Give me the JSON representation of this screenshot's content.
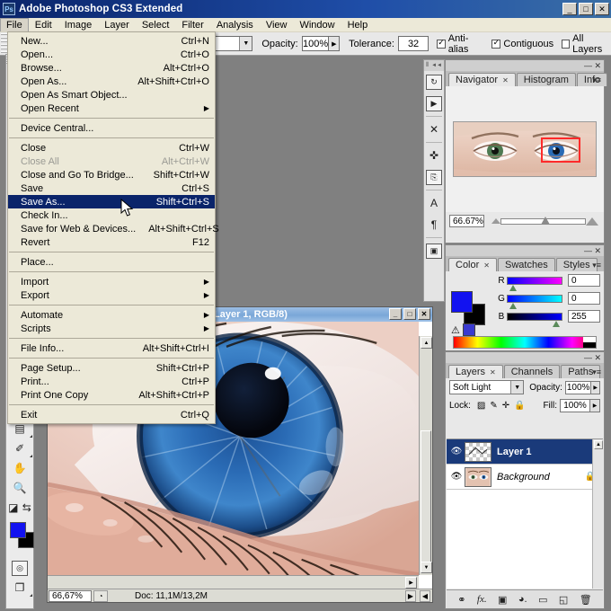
{
  "window": {
    "title": "Adobe Photoshop CS3 Extended",
    "logo": "ps-logo",
    "minimize": "_",
    "maximize": "□",
    "close": "✕"
  },
  "menubar": {
    "items": [
      {
        "label": "File"
      },
      {
        "label": "Edit"
      },
      {
        "label": "Image"
      },
      {
        "label": "Layer"
      },
      {
        "label": "Select"
      },
      {
        "label": "Filter"
      },
      {
        "label": "Analysis"
      },
      {
        "label": "View"
      },
      {
        "label": "Window"
      },
      {
        "label": "Help"
      }
    ]
  },
  "file_menu": {
    "items": [
      {
        "label": "New...",
        "accel": "Ctrl+N",
        "type": "item"
      },
      {
        "label": "Open...",
        "accel": "Ctrl+O",
        "type": "item"
      },
      {
        "label": "Browse...",
        "accel": "Alt+Ctrl+O",
        "type": "item"
      },
      {
        "label": "Open As...",
        "accel": "Alt+Shift+Ctrl+O",
        "type": "item"
      },
      {
        "label": "Open As Smart Object...",
        "accel": "",
        "type": "item"
      },
      {
        "label": "Open Recent",
        "accel": "",
        "type": "submenu"
      },
      {
        "type": "separator"
      },
      {
        "label": "Device Central...",
        "accel": "",
        "type": "item"
      },
      {
        "type": "separator"
      },
      {
        "label": "Close",
        "accel": "Ctrl+W",
        "type": "item"
      },
      {
        "label": "Close All",
        "accel": "Alt+Ctrl+W",
        "type": "disabled"
      },
      {
        "label": "Close and Go To Bridge...",
        "accel": "Shift+Ctrl+W",
        "type": "item"
      },
      {
        "label": "Save",
        "accel": "Ctrl+S",
        "type": "item"
      },
      {
        "label": "Save As...",
        "accel": "Shift+Ctrl+S",
        "type": "selected"
      },
      {
        "label": "Check In...",
        "accel": "",
        "type": "item"
      },
      {
        "label": "Save for Web & Devices...",
        "accel": "Alt+Shift+Ctrl+S",
        "type": "item"
      },
      {
        "label": "Revert",
        "accel": "F12",
        "type": "item"
      },
      {
        "type": "separator"
      },
      {
        "label": "Place...",
        "accel": "",
        "type": "item"
      },
      {
        "type": "separator"
      },
      {
        "label": "Import",
        "accel": "",
        "type": "submenu"
      },
      {
        "label": "Export",
        "accel": "",
        "type": "submenu"
      },
      {
        "type": "separator"
      },
      {
        "label": "Automate",
        "accel": "",
        "type": "submenu"
      },
      {
        "label": "Scripts",
        "accel": "",
        "type": "submenu"
      },
      {
        "type": "separator"
      },
      {
        "label": "File Info...",
        "accel": "Alt+Shift+Ctrl+I",
        "type": "item"
      },
      {
        "type": "separator"
      },
      {
        "label": "Page Setup...",
        "accel": "Shift+Ctrl+P",
        "type": "item"
      },
      {
        "label": "Print...",
        "accel": "Ctrl+P",
        "type": "item"
      },
      {
        "label": "Print One Copy",
        "accel": "Alt+Shift+Ctrl+P",
        "type": "item"
      },
      {
        "type": "separator"
      },
      {
        "label": "Exit",
        "accel": "Ctrl+Q",
        "type": "item"
      }
    ]
  },
  "options_bar": {
    "preset_value": "",
    "opacity_label": "Opacity:",
    "opacity_value": "100%",
    "tolerance_label": "Tolerance:",
    "tolerance_value": "32",
    "antialias_label": "Anti-alias",
    "antialias_checked": true,
    "contiguous_label": "Contiguous",
    "contiguous_checked": true,
    "alllayers_label": "All Layers",
    "alllayers_checked": false,
    "check_glyph": "✓"
  },
  "toolbox": {
    "tools": [
      {
        "name": "notes-tool",
        "glyph": "▤"
      },
      {
        "name": "eyedropper-tool",
        "glyph": "✐"
      },
      {
        "name": "hand-tool",
        "glyph": "✋"
      },
      {
        "name": "zoom-tool",
        "glyph": "🔍"
      },
      {
        "name": "default-colors-tool",
        "glyph": "◪"
      },
      {
        "name": "swap-colors-tool",
        "glyph": "⇆"
      }
    ],
    "foreground_color": "#1212f0",
    "background_color": "#000000",
    "quickmask_glyph": "◎",
    "screenmode_glyph": "❐"
  },
  "dock_strip": {
    "collapse_glyph": "◄◄",
    "icons": [
      {
        "name": "history-icon",
        "glyph": "↻"
      },
      {
        "name": "actions-icon",
        "glyph": "▶"
      },
      {
        "name": "tool-presets-icon",
        "glyph": "✕"
      },
      {
        "name": "brushes-icon",
        "glyph": "✜"
      },
      {
        "name": "clone-source-icon",
        "glyph": "⎘"
      },
      {
        "name": "character-icon",
        "glyph": "A"
      },
      {
        "name": "paragraph-icon",
        "glyph": "¶"
      },
      {
        "name": "layer-comps-icon",
        "glyph": "▣"
      }
    ]
  },
  "navigator": {
    "tabs": [
      {
        "label": "Navigator",
        "active": true,
        "closable": true
      },
      {
        "label": "Histogram",
        "active": false,
        "closable": false
      },
      {
        "label": "Info",
        "active": false,
        "closable": false
      }
    ],
    "zoom_value": "66.67%",
    "minimize": "—",
    "close": "✕",
    "menu_glyph": "▾≡"
  },
  "color_panel": {
    "tabs": [
      {
        "label": "Color",
        "active": true,
        "closable": true
      },
      {
        "label": "Swatches",
        "active": false,
        "closable": false
      },
      {
        "label": "Styles",
        "active": false,
        "closable": false
      }
    ],
    "channels": [
      {
        "letter": "R",
        "value": "0"
      },
      {
        "letter": "G",
        "value": "0"
      },
      {
        "letter": "B",
        "value": "255"
      }
    ],
    "foreground_color": "#1212f0",
    "background_color": "#000000",
    "warning_glyph": "⚠",
    "menu_glyph": "▾≡"
  },
  "layers_panel": {
    "tabs": [
      {
        "label": "Layers",
        "active": true,
        "closable": true
      },
      {
        "label": "Channels",
        "active": false,
        "closable": false
      },
      {
        "label": "Paths",
        "active": false,
        "closable": false
      }
    ],
    "blend_mode": "Soft Light",
    "opacity_label": "Opacity:",
    "opacity_value": "100%",
    "lock_label": "Lock:",
    "fill_label": "Fill:",
    "fill_value": "100%",
    "lock_icons": [
      {
        "name": "lock-transparent-pixels-icon",
        "glyph": "▨"
      },
      {
        "name": "lock-image-pixels-icon",
        "glyph": "✎"
      },
      {
        "name": "lock-position-icon",
        "glyph": "✛"
      },
      {
        "name": "lock-all-icon",
        "glyph": "🔒"
      }
    ],
    "layers": [
      {
        "name": "Layer 1",
        "selected": true,
        "visible": true,
        "locked": false,
        "kind": "transparent"
      },
      {
        "name": "Background",
        "selected": false,
        "visible": true,
        "locked": true,
        "kind": "image"
      }
    ],
    "eye_glyph": "👁",
    "lock_glyph": "🔒",
    "footer_icons": [
      {
        "name": "link-layers-icon",
        "glyph": "⚭"
      },
      {
        "name": "layer-style-fx-icon",
        "glyph": "fx."
      },
      {
        "name": "add-layer-mask-icon",
        "glyph": "▣"
      },
      {
        "name": "new-adjustment-layer-icon",
        "glyph": "◕."
      },
      {
        "name": "new-group-icon",
        "glyph": "▭"
      },
      {
        "name": "new-layer-icon",
        "glyph": "◱"
      },
      {
        "name": "delete-layer-icon",
        "glyph": "🗑"
      }
    ],
    "menu_glyph": "▾≡"
  },
  "document": {
    "title": "Layer 1, RGB/8)",
    "minimize": "_",
    "maximize": "□",
    "close": "✕",
    "zoom": "66,67%",
    "doc_info": "Doc: 11,1M/13,2M",
    "status_icon": "◔",
    "arrow_right": "▶",
    "arrow_left": "◀"
  },
  "colors": {
    "titlebar_start": "#0a246a",
    "menu_highlight": "#0a246a",
    "desktop": "#808080",
    "panel_bg": "#e8e8e8",
    "doc_title": "#7aa7d8",
    "layer_selected": "#1a3a7a",
    "nav_viewrect": "#ff2a2a",
    "iris_blue": "#1f5ea8"
  }
}
